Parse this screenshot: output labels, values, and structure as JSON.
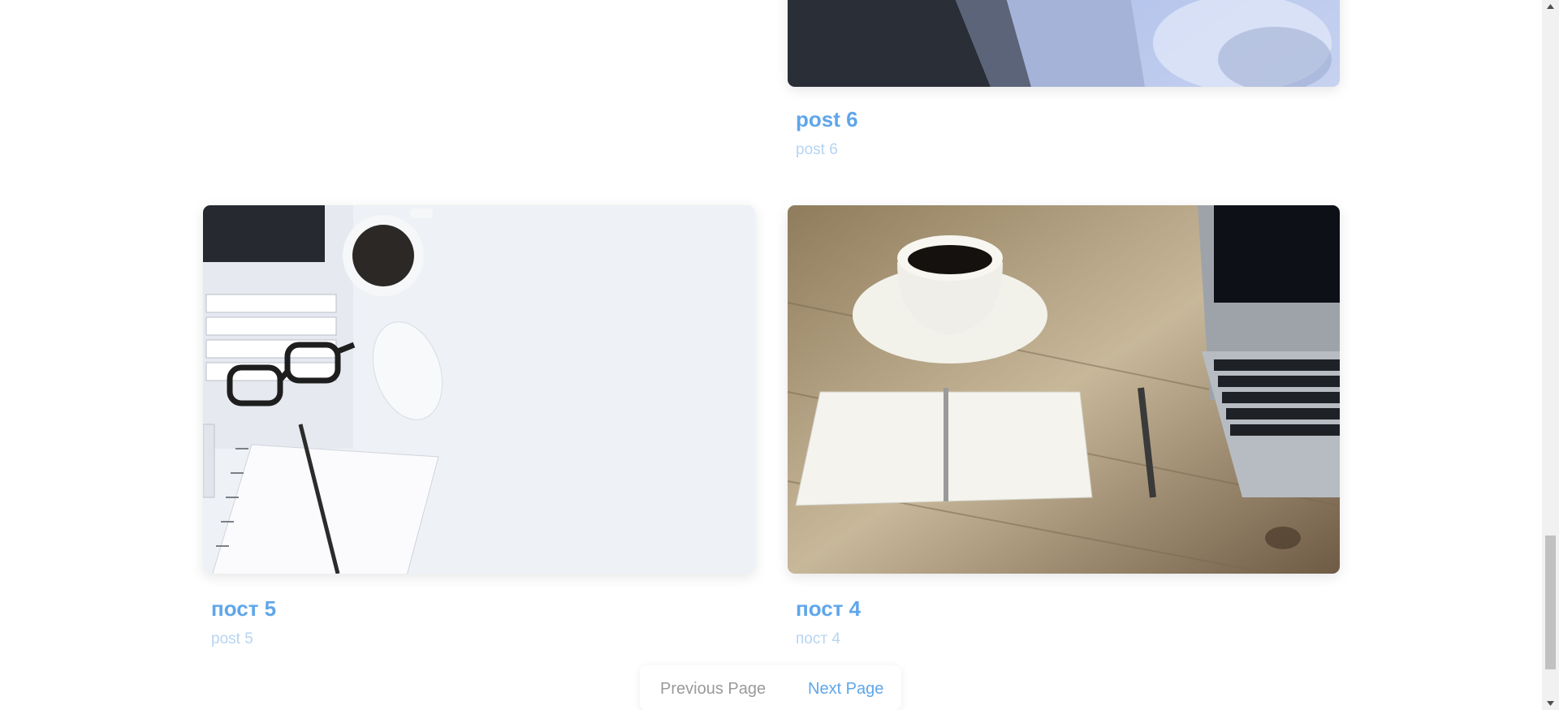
{
  "posts": [
    {
      "title": "post 6",
      "excerpt": "post 6",
      "image": "blurred-blue-photo"
    },
    {
      "title": "пост 5",
      "excerpt": "post 5",
      "image": "white-desk-laptop-coffee-notebook-photo"
    },
    {
      "title": "пост 4",
      "excerpt": "пост 4",
      "image": "wooden-desk-coffee-notebook-laptop-photo"
    }
  ],
  "pagination": {
    "previous_label": "Previous Page",
    "next_label": "Next Page"
  },
  "colors": {
    "link": "#5fa6ea",
    "excerpt": "#b6d4f2",
    "disabled": "#9a9a9a"
  }
}
